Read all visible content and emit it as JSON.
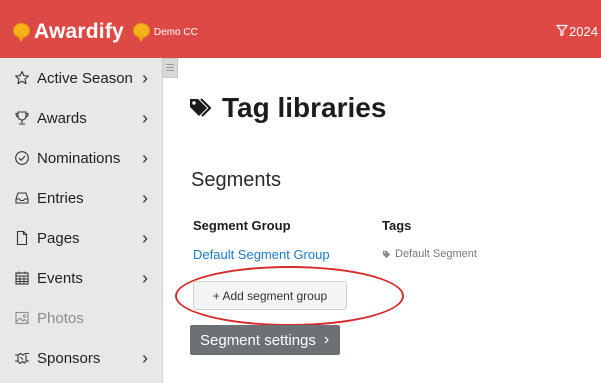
{
  "header": {
    "brand": "Awardify",
    "org": "Demo CC",
    "season_filter": "2024",
    "colors": {
      "bar": "#dd4a45",
      "medal": "#f6b21a"
    }
  },
  "sidebar": {
    "items": [
      {
        "label": "Active Season",
        "icon": "star-icon",
        "has_arrow": true
      },
      {
        "label": "Awards",
        "icon": "trophy-icon",
        "has_arrow": true
      },
      {
        "label": "Nominations",
        "icon": "check-circle-icon",
        "has_arrow": true
      },
      {
        "label": "Entries",
        "icon": "inbox-icon",
        "has_arrow": true
      },
      {
        "label": "Pages",
        "icon": "page-icon",
        "has_arrow": true
      },
      {
        "label": "Events",
        "icon": "calendar-icon",
        "has_arrow": true
      },
      {
        "label": "Photos",
        "icon": "photo-icon",
        "has_arrow": false,
        "disabled": true
      },
      {
        "label": "Sponsors",
        "icon": "handshake-icon",
        "has_arrow": true
      }
    ]
  },
  "main": {
    "title": "Tag libraries",
    "section": "Segments",
    "columns": [
      "Segment Group",
      "Tags"
    ],
    "rows": [
      {
        "group": "Default Segment Group",
        "tag": "Default Segment"
      }
    ],
    "add_button": "+ Add segment group",
    "settings_button": "Segment settings",
    "highlight_color": "#d62b2b"
  }
}
